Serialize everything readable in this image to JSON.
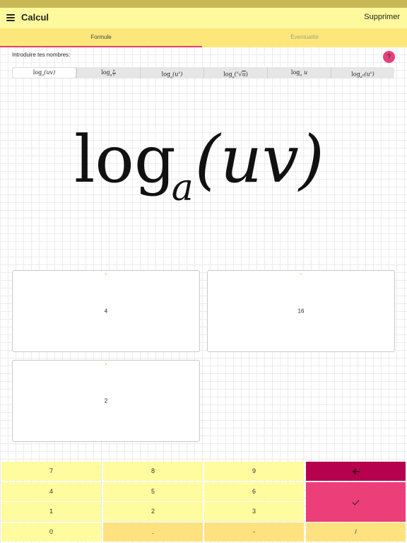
{
  "app": {
    "title": "Calcul",
    "delete_label": "Supprimer"
  },
  "tabs": [
    {
      "label": "Formule",
      "active": true
    },
    {
      "label": "Éventualité",
      "active": false
    }
  ],
  "prompt": "Introduire tes nombres:",
  "help_label": "?",
  "formula_options": [
    {
      "func": "log",
      "base": "a",
      "arg": "(uv)",
      "selected": true
    },
    {
      "func": "log",
      "base": "a",
      "arg_fraction": {
        "numerator": "u",
        "denominator": "v"
      }
    },
    {
      "func": "log",
      "base": "a",
      "arg": "(u",
      "exponent": "v",
      "arg_close": ")"
    },
    {
      "func": "log",
      "base": "a",
      "arg_root": {
        "index": "v",
        "radicand": "u"
      }
    },
    {
      "func": "log",
      "base": "a",
      "arg": "u"
    },
    {
      "func": "log",
      "base": "a",
      "base_exponent": "v",
      "arg": "(u",
      "exponent": "v",
      "arg_close": ")"
    }
  ],
  "formula_display": {
    "func": "log",
    "base": "a",
    "arg": "(uv)"
  },
  "inputs": [
    {
      "label": "u",
      "value": "4"
    },
    {
      "label": "v",
      "value": "16"
    },
    {
      "label": "a",
      "value": "2"
    }
  ],
  "keypad": {
    "keys": [
      "7",
      "8",
      "9",
      "4",
      "5",
      "6",
      "1",
      "2",
      "3",
      "0",
      ".",
      "-",
      "/"
    ],
    "backspace_icon": "backspace-arrow-icon",
    "confirm_icon": "check-icon"
  },
  "colors": {
    "accent": "#e2426d",
    "app_bar": "#fef99c",
    "tab_bar": "#fde67a",
    "backspace": "#b5014e",
    "confirm": "#ec3f79"
  }
}
